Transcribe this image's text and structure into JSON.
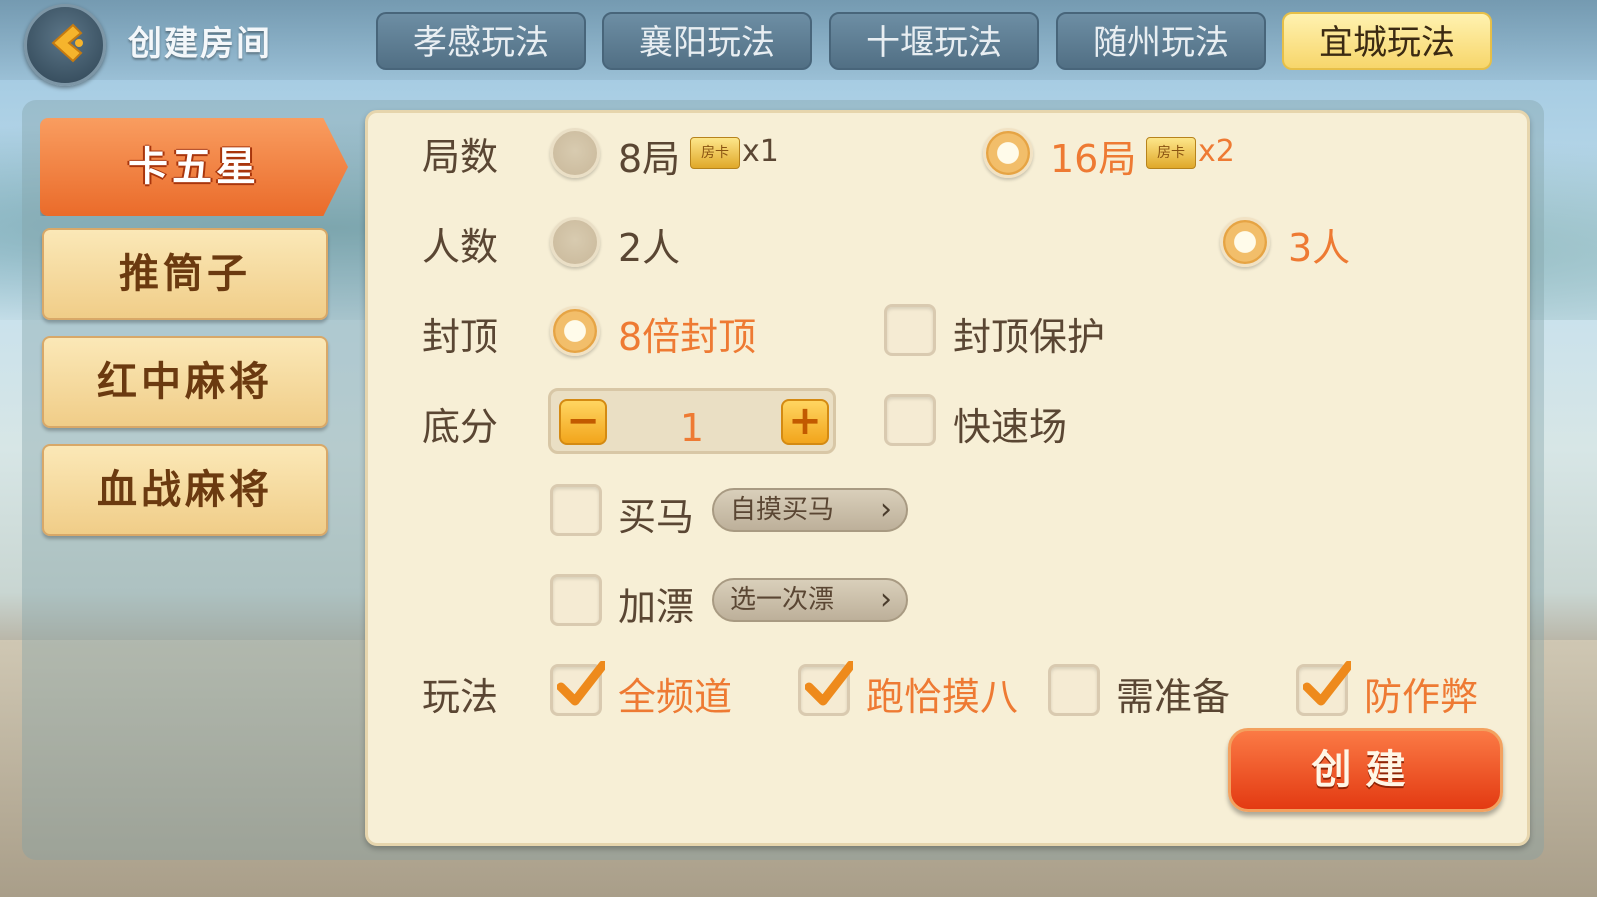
{
  "header": {
    "title": "创建房间",
    "tabs": [
      {
        "label": "孝感玩法",
        "active": false
      },
      {
        "label": "襄阳玩法",
        "active": false
      },
      {
        "label": "十堰玩法",
        "active": false
      },
      {
        "label": "随州玩法",
        "active": false
      },
      {
        "label": "宜城玩法",
        "active": true
      }
    ]
  },
  "modes": [
    {
      "label": "卡五星",
      "active": true
    },
    {
      "label": "推筒子",
      "active": false
    },
    {
      "label": "红中麻将",
      "active": false
    },
    {
      "label": "血战麻将",
      "active": false
    }
  ],
  "rows": {
    "rounds": {
      "label": "局数",
      "opt1": "8局",
      "opt1_mult": "x1",
      "opt2": "16局",
      "opt2_mult": "x2",
      "card_icon_text": "房卡"
    },
    "players": {
      "label": "人数",
      "opt1": "2人",
      "opt2": "3人"
    },
    "cap": {
      "label": "封顶",
      "opt1": "8倍封顶",
      "opt2": "封顶保护"
    },
    "base": {
      "label": "底分",
      "value": "1",
      "minus": "−",
      "plus": "+",
      "fast": "快速场"
    },
    "buy_horse": {
      "label": "买马",
      "pill": "自摸买马"
    },
    "piao": {
      "label": "加漂",
      "pill": "选一次漂"
    },
    "play": {
      "label": "玩法",
      "opt1": "全频道",
      "opt2": "跑恰摸八",
      "opt3": "需准备",
      "opt4": "防作弊"
    }
  },
  "create_label": "创建",
  "colors": {
    "accent": "#ee7a33",
    "panel": "#f7efd6",
    "tab_active": "#f7d66b",
    "text": "#5a4633"
  },
  "icons": {
    "back": "back-arrow-icon",
    "chevron": "chevron-right-icon",
    "check": "checkmark-icon"
  }
}
